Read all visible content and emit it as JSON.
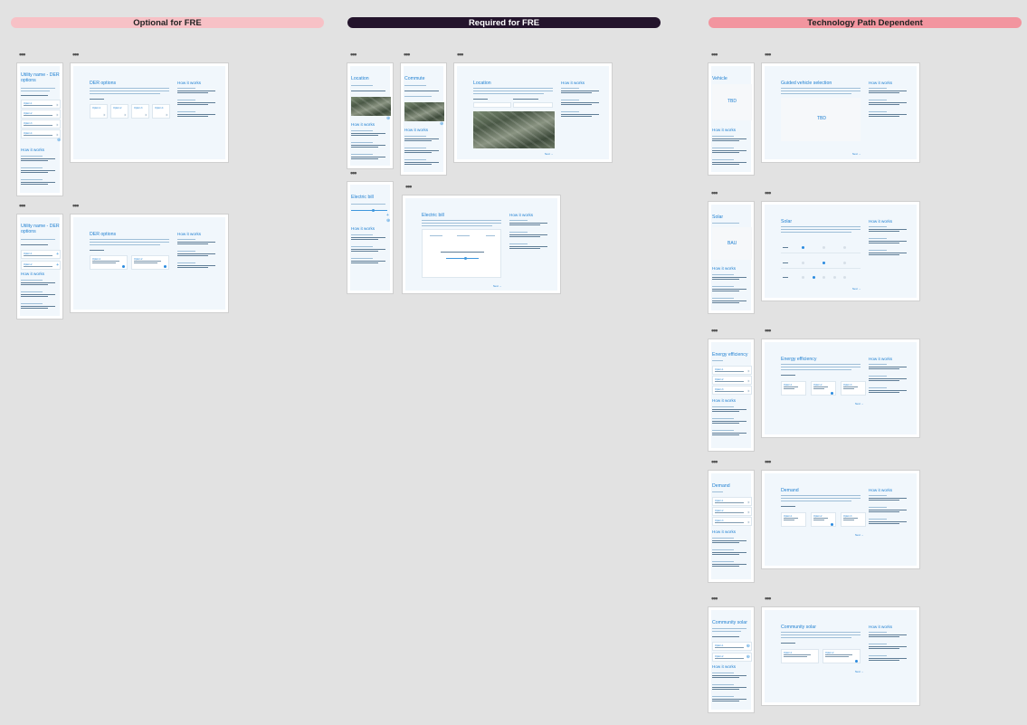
{
  "sections": {
    "optional": {
      "label": "Optional for FRE",
      "bg": "#f7c1c6",
      "fg": "#222"
    },
    "required": {
      "label": "Required for FRE",
      "bg": "#24142c",
      "fg": "#ffffff"
    },
    "tech": {
      "label": "Technology Path Dependent",
      "bg": "#f2959f",
      "fg": "#222"
    }
  },
  "frames": {
    "utility_mobile_1": {
      "title": "Utility name - DER options",
      "how": "How it works"
    },
    "der_desktop_1": {
      "title": "DER options",
      "how": "How it works",
      "opts": [
        "Option 1",
        "Option 2",
        "Option 3",
        "Option 4"
      ]
    },
    "utility_mobile_2": {
      "title": "Utility name - DER options",
      "how": "How it works"
    },
    "der_desktop_2": {
      "title": "DER options",
      "how": "How it works",
      "opts": [
        "Option 1",
        "Option 2"
      ]
    },
    "location_mobile": {
      "title": "Location",
      "how": "How it works"
    },
    "commute_mobile": {
      "title": "Commute",
      "how": "How it works"
    },
    "location_desktop": {
      "title": "Location",
      "how": "How it works"
    },
    "electric_mobile": {
      "title": "Electric bill",
      "how": "How it works"
    },
    "electric_desktop": {
      "title": "Electric bill",
      "how": "How it works"
    },
    "vehicle_mobile": {
      "title": "Vehicle",
      "tbd": "TBD",
      "how": "How it works"
    },
    "vehicle_desktop": {
      "title": "Guided vehicle selection",
      "tbd": "TBD",
      "how": "How it works"
    },
    "solar_mobile": {
      "title": "Solar",
      "tbd": "BAU",
      "how": "How it works"
    },
    "solar_desktop": {
      "title": "Solar",
      "how": "How it works"
    },
    "energy_mobile": {
      "title": "Energy efficiency",
      "how": "How it works"
    },
    "energy_desktop": {
      "title": "Energy efficiency",
      "how": "How it works",
      "opts": [
        "Option 1",
        "Option 2",
        "Option 3"
      ]
    },
    "demand_mobile": {
      "title": "Demand",
      "how": "How it works"
    },
    "demand_desktop": {
      "title": "Demand",
      "how": "How it works",
      "opts": [
        "Option 1",
        "Option 2",
        "Option 3"
      ]
    },
    "community_mobile": {
      "title": "Community solar",
      "how": "How it works"
    },
    "community_desktop": {
      "title": "Community solar",
      "how": "How it works",
      "opts": [
        "Option 1",
        "Option 2"
      ]
    }
  },
  "dots_glyph": "•••"
}
